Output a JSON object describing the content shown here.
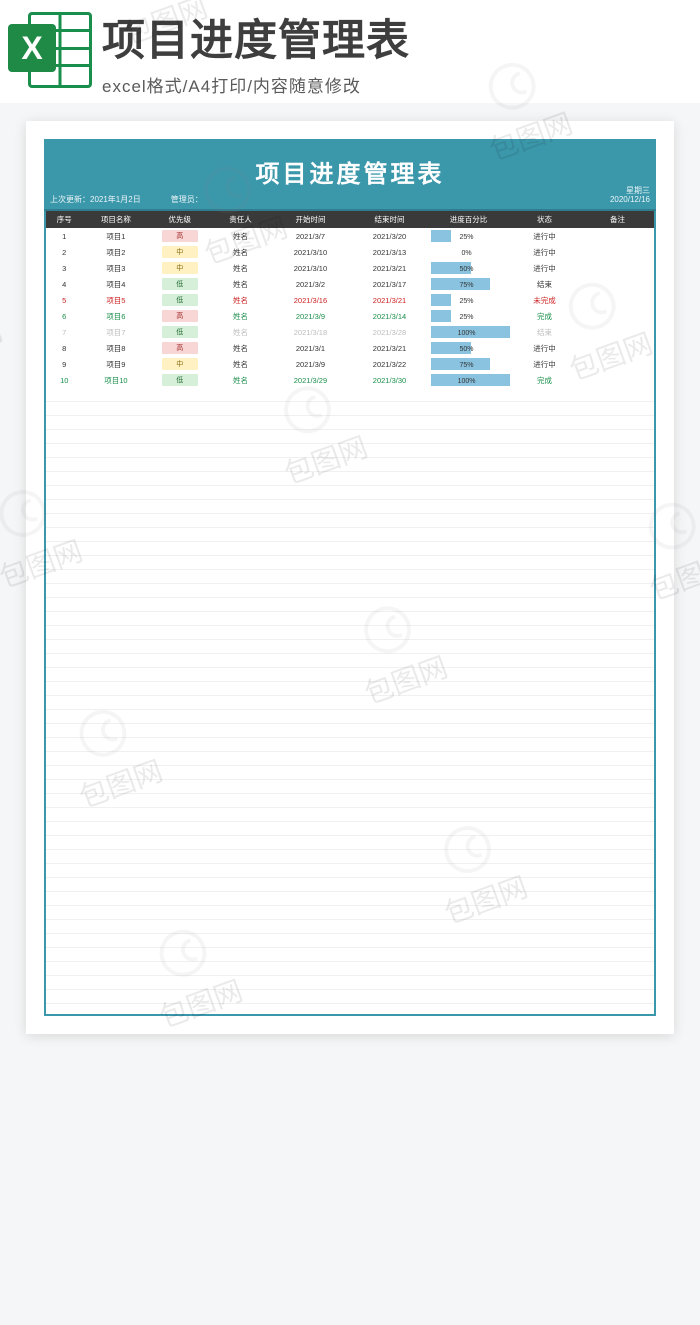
{
  "ribbon": {
    "icon_letter": "X",
    "title": "项目进度管理表",
    "subtitle": "excel格式/A4打印/内容随意修改"
  },
  "sheet": {
    "banner_title": "项目进度管理表",
    "meta_update_label": "上次更新：",
    "meta_update_value": "2021年1月2日",
    "meta_manager_label": "管理员：",
    "meta_weekday": "星期三",
    "meta_date": "2020/12/16"
  },
  "columns": [
    "序号",
    "项目名称",
    "优先级",
    "责任人",
    "开始时间",
    "结束时间",
    "进度百分比",
    "状态",
    "备注"
  ],
  "priority_labels": {
    "high": "高",
    "mid": "中",
    "low": "低"
  },
  "rows": [
    {
      "idx": "1",
      "name": "项目1",
      "pri": "high",
      "owner": "姓名",
      "start": "2021/3/7",
      "end": "2021/3/20",
      "pct": 25,
      "status": "进行中",
      "style": ""
    },
    {
      "idx": "2",
      "name": "项目2",
      "pri": "mid",
      "owner": "姓名",
      "start": "2021/3/10",
      "end": "2021/3/13",
      "pct": 0,
      "status": "进行中",
      "style": ""
    },
    {
      "idx": "3",
      "name": "项目3",
      "pri": "mid",
      "owner": "姓名",
      "start": "2021/3/10",
      "end": "2021/3/21",
      "pct": 50,
      "status": "进行中",
      "style": ""
    },
    {
      "idx": "4",
      "name": "项目4",
      "pri": "low",
      "owner": "姓名",
      "start": "2021/3/2",
      "end": "2021/3/17",
      "pct": 75,
      "status": "结束",
      "style": ""
    },
    {
      "idx": "5",
      "name": "项目5",
      "pri": "low",
      "owner": "姓名",
      "start": "2021/3/16",
      "end": "2021/3/21",
      "pct": 25,
      "status": "未完成",
      "style": "red"
    },
    {
      "idx": "6",
      "name": "项目6",
      "pri": "high",
      "owner": "姓名",
      "start": "2021/3/9",
      "end": "2021/3/14",
      "pct": 25,
      "status": "完成",
      "style": "green"
    },
    {
      "idx": "7",
      "name": "项目7",
      "pri": "low",
      "owner": "姓名",
      "start": "2021/3/18",
      "end": "2021/3/28",
      "pct": 100,
      "status": "结束",
      "style": "gray"
    },
    {
      "idx": "8",
      "name": "项目8",
      "pri": "high",
      "owner": "姓名",
      "start": "2021/3/1",
      "end": "2021/3/21",
      "pct": 50,
      "status": "进行中",
      "style": ""
    },
    {
      "idx": "9",
      "name": "项目9",
      "pri": "mid",
      "owner": "姓名",
      "start": "2021/3/9",
      "end": "2021/3/22",
      "pct": 75,
      "status": "进行中",
      "style": ""
    },
    {
      "idx": "10",
      "name": "项目10",
      "pri": "low",
      "owner": "姓名",
      "start": "2021/3/29",
      "end": "2021/3/30",
      "pct": 100,
      "status": "完成",
      "style": "green"
    }
  ],
  "watermark": "包图网"
}
